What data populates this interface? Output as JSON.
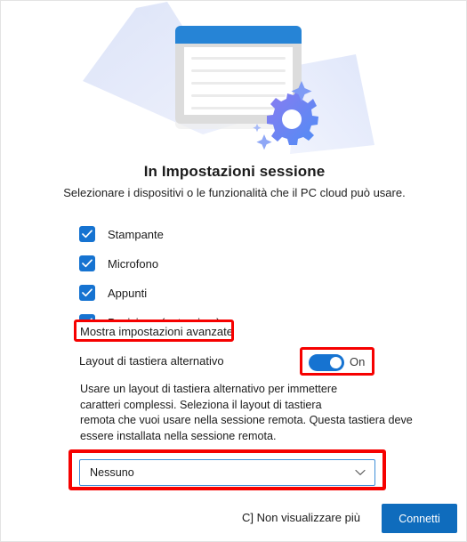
{
  "window": {
    "title": "In Impostazioni sessione",
    "subtitle": "Selezionare i dispositivi o le funzionalità che il PC cloud può usare."
  },
  "illustration": {
    "name": "session-settings-illustration",
    "colors": {
      "window_titlebar": "#2684d6",
      "window_body": "#dcdcdc",
      "paper": "#ffffff",
      "card_back": "#e2e8fa",
      "card_front": "#e9edfb",
      "gear_start": "#8b7bf0",
      "gear_end": "#4f8df5",
      "sparkle": "#7e9bf5"
    }
  },
  "devices": {
    "items": [
      {
        "label": "Stampante",
        "checked": true
      },
      {
        "label": "Microfono",
        "checked": true
      },
      {
        "label": "Appunti",
        "checked": true
      },
      {
        "label": "Posizione (anteprima)",
        "checked": true
      }
    ]
  },
  "advanced": {
    "link_label": "Mostra impostazioni avanzate n",
    "highlight_color": "#f60100"
  },
  "keyboard": {
    "toggle_label": "Layout di tastiera alternativo",
    "toggle_state": "On",
    "toggle_on": true,
    "toggle_color": "#1673d1",
    "description_lines": [
      "Usare un layout di tastiera alternativo per immettere",
      "caratteri complessi. Seleziona il layout di tastiera",
      "remota che vuoi usare nella sessione remota.  Questa tastiera deve",
      "essere installata nella sessione remota."
    ],
    "dropdown_value": "Nessuno",
    "dropdown_border_color": "#3f8fd8",
    "highlight_color": "#f60100"
  },
  "footer": {
    "dont_show_label": "C] Non visualizzare più",
    "connect_label": "Connetti",
    "connect_color": "#0f6cbd"
  },
  "icons": {
    "check": "check-icon",
    "chevron_down": "chevron-down-icon"
  }
}
